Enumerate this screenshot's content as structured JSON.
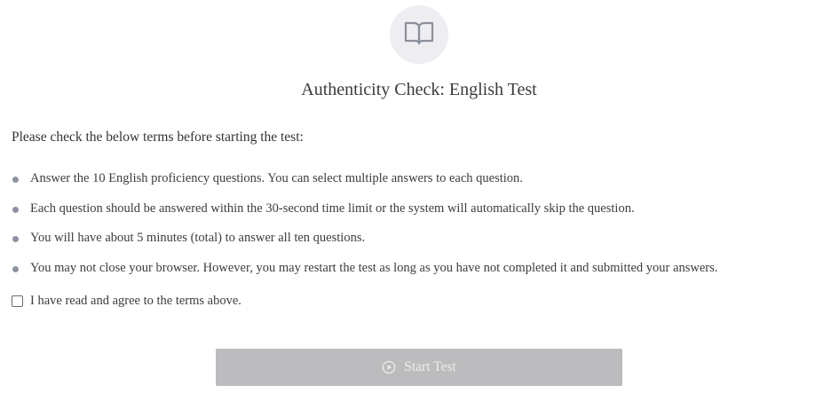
{
  "header": {
    "icon": "open-book-icon",
    "title": "Authenticity Check: English Test"
  },
  "instructions": {
    "intro": "Please check the below terms before starting the test:",
    "terms": [
      "Answer the 10 English proficiency questions. You can select multiple answers to each question.",
      "Each question should be answered within the 30-second time limit or the system will automatically skip the question.",
      "You will have about 5 minutes (total) to answer all ten questions.",
      "You may not close your browser. However, you may restart the test as long as you have not completed it and submitted your answers."
    ]
  },
  "agreement": {
    "label": "I have read and agree to the terms above.",
    "checked": false
  },
  "start_button": {
    "label": "Start Test",
    "icon": "play-circle-icon",
    "enabled": false
  },
  "colors": {
    "icon_circle_bg": "#eeeef2",
    "bullet": "#8d93a0",
    "button_disabled_bg": "#bcbcbe",
    "button_text": "#eeeeee"
  }
}
